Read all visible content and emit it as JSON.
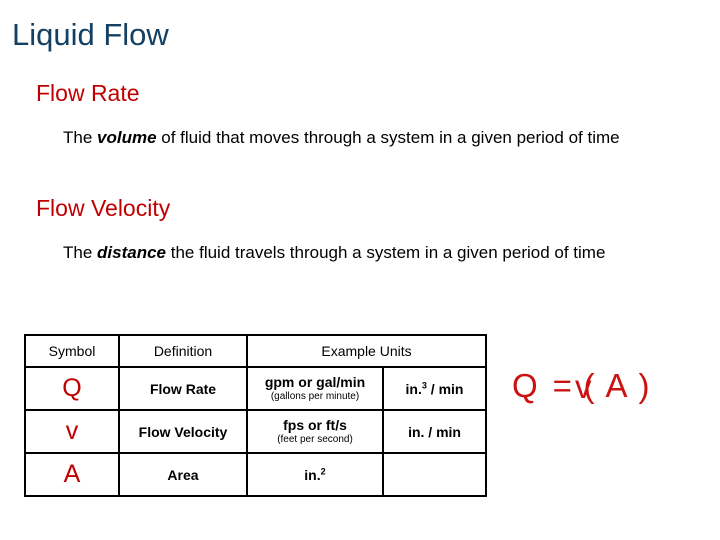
{
  "slide": {
    "title": "Liquid Flow",
    "background_color": "#ffffff",
    "title_color": "#134063",
    "heading_color": "#c00000",
    "formula_color": "#cc1111"
  },
  "sections": [
    {
      "heading": "Flow Rate",
      "body_prefix": "The ",
      "body_emphasis": "volume",
      "body_suffix": " of fluid that moves through a system in a given period of time"
    },
    {
      "heading": "Flow Velocity",
      "body_prefix": "The ",
      "body_emphasis": "distance",
      "body_suffix": " the fluid travels through a system in a given period of time"
    }
  ],
  "table": {
    "headers": {
      "symbol": "Symbol",
      "definition": "Definition",
      "example_units": "Example Units"
    },
    "rows": [
      {
        "symbol": "Q",
        "definition": "Flow Rate",
        "unit_main": "gpm or gal/min",
        "unit_sub": "(gallons per minute)",
        "unit_alt_prefix": "in.",
        "unit_alt_sup": "3",
        "unit_alt_suffix": " / min"
      },
      {
        "symbol": "v",
        "definition": "Flow Velocity",
        "unit_main": "fps or ft/s",
        "unit_sub": "(feet per second)",
        "unit_alt_prefix": "in. / min",
        "unit_alt_sup": "",
        "unit_alt_suffix": ""
      },
      {
        "symbol": "A",
        "definition": "Area",
        "unit_main": "in.",
        "unit_main_sup": "2",
        "unit_sub": "",
        "unit_alt_prefix": "",
        "unit_alt_sup": "",
        "unit_alt_suffix": ""
      }
    ]
  },
  "formula": {
    "left": "Q",
    "equals": "=",
    "velocity": "v",
    "paren_open": "(",
    "area": "A",
    "paren_close": ")",
    "full": "Q = v ( A )"
  }
}
